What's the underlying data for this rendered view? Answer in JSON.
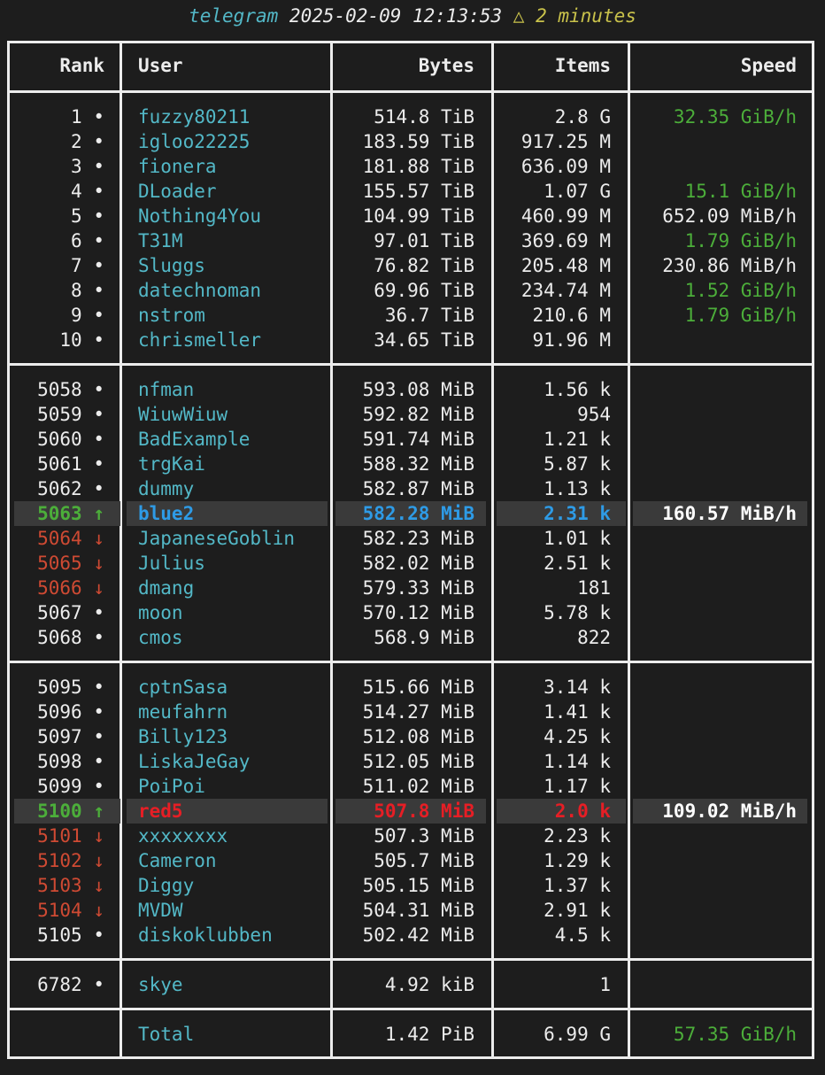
{
  "title": {
    "app": "telegram",
    "timestamp": "2025-02-09 12:13:53",
    "ago": "△ 2 minutes"
  },
  "headers": {
    "rank": "Rank",
    "user": "User",
    "bytes": "Bytes",
    "items": "Items",
    "speed": "Speed"
  },
  "groups": [
    {
      "rows": [
        {
          "rank": "1",
          "marker": "•",
          "trend": "same",
          "user": "fuzzy80211",
          "bytes": "514.8 TiB",
          "items": "2.8 G",
          "speed": "32.35 GiB/h",
          "speed_color": "green"
        },
        {
          "rank": "2",
          "marker": "•",
          "trend": "same",
          "user": "igloo22225",
          "bytes": "183.59 TiB",
          "items": "917.25 M",
          "speed": ""
        },
        {
          "rank": "3",
          "marker": "•",
          "trend": "same",
          "user": "fionera",
          "bytes": "181.88 TiB",
          "items": "636.09 M",
          "speed": ""
        },
        {
          "rank": "4",
          "marker": "•",
          "trend": "same",
          "user": "DLoader",
          "bytes": "155.57 TiB",
          "items": "1.07 G",
          "speed": "15.1 GiB/h",
          "speed_color": "green"
        },
        {
          "rank": "5",
          "marker": "•",
          "trend": "same",
          "user": "Nothing4You",
          "bytes": "104.99 TiB",
          "items": "460.99 M",
          "speed": "652.09 MiB/h",
          "speed_color": "white"
        },
        {
          "rank": "6",
          "marker": "•",
          "trend": "same",
          "user": "T31M",
          "bytes": "97.01 TiB",
          "items": "369.69 M",
          "speed": "1.79 GiB/h",
          "speed_color": "green"
        },
        {
          "rank": "7",
          "marker": "•",
          "trend": "same",
          "user": "Sluggs",
          "bytes": "76.82 TiB",
          "items": "205.48 M",
          "speed": "230.86 MiB/h",
          "speed_color": "white"
        },
        {
          "rank": "8",
          "marker": "•",
          "trend": "same",
          "user": "datechnoman",
          "bytes": "69.96 TiB",
          "items": "234.74 M",
          "speed": "1.52 GiB/h",
          "speed_color": "green"
        },
        {
          "rank": "9",
          "marker": "•",
          "trend": "same",
          "user": "nstrom",
          "bytes": "36.7 TiB",
          "items": "210.6 M",
          "speed": "1.79 GiB/h",
          "speed_color": "green"
        },
        {
          "rank": "10",
          "marker": "•",
          "trend": "same",
          "user": "chrismeller",
          "bytes": "34.65 TiB",
          "items": "91.96 M",
          "speed": ""
        }
      ]
    },
    {
      "speed": "160.57 MiB/h",
      "rows": [
        {
          "rank": "5058",
          "marker": "•",
          "trend": "same",
          "user": "nfman",
          "bytes": "593.08 MiB",
          "items": "1.56 k"
        },
        {
          "rank": "5059",
          "marker": "•",
          "trend": "same",
          "user": "WiuwWiuw",
          "bytes": "592.82 MiB",
          "items": "954"
        },
        {
          "rank": "5060",
          "marker": "•",
          "trend": "same",
          "user": "BadExample",
          "bytes": "591.74 MiB",
          "items": "1.21 k"
        },
        {
          "rank": "5061",
          "marker": "•",
          "trend": "same",
          "user": "trgKai",
          "bytes": "588.32 MiB",
          "items": "5.87 k"
        },
        {
          "rank": "5062",
          "marker": "•",
          "trend": "same",
          "user": "dummy",
          "bytes": "582.87 MiB",
          "items": "1.13 k"
        },
        {
          "rank": "5063",
          "marker": "↑",
          "trend": "up",
          "user": "blue2",
          "bytes": "582.28 MiB",
          "items": "2.31 k",
          "highlight": "blue"
        },
        {
          "rank": "5064",
          "marker": "↓",
          "trend": "down",
          "user": "JapaneseGoblin",
          "bytes": "582.23 MiB",
          "items": "1.01 k"
        },
        {
          "rank": "5065",
          "marker": "↓",
          "trend": "down",
          "user": "Julius",
          "bytes": "582.02 MiB",
          "items": "2.51 k"
        },
        {
          "rank": "5066",
          "marker": "↓",
          "trend": "down",
          "user": "dmang",
          "bytes": "579.33 MiB",
          "items": "181"
        },
        {
          "rank": "5067",
          "marker": "•",
          "trend": "same",
          "user": "moon",
          "bytes": "570.12 MiB",
          "items": "5.78 k"
        },
        {
          "rank": "5068",
          "marker": "•",
          "trend": "same",
          "user": "cmos",
          "bytes": "568.9 MiB",
          "items": "822"
        }
      ]
    },
    {
      "speed": "109.02 MiB/h",
      "rows": [
        {
          "rank": "5095",
          "marker": "•",
          "trend": "same",
          "user": "cptnSasa",
          "bytes": "515.66 MiB",
          "items": "3.14 k"
        },
        {
          "rank": "5096",
          "marker": "•",
          "trend": "same",
          "user": "meufahrn",
          "bytes": "514.27 MiB",
          "items": "1.41 k"
        },
        {
          "rank": "5097",
          "marker": "•",
          "trend": "same",
          "user": "Billy123",
          "bytes": "512.08 MiB",
          "items": "4.25 k"
        },
        {
          "rank": "5098",
          "marker": "•",
          "trend": "same",
          "user": "LiskaJeGay",
          "bytes": "512.05 MiB",
          "items": "1.14 k"
        },
        {
          "rank": "5099",
          "marker": "•",
          "trend": "same",
          "user": "PoiPoi",
          "bytes": "511.02 MiB",
          "items": "1.17 k"
        },
        {
          "rank": "5100",
          "marker": "↑",
          "trend": "up",
          "user": "red5",
          "bytes": "507.8 MiB",
          "items": "2.0 k",
          "highlight": "red"
        },
        {
          "rank": "5101",
          "marker": "↓",
          "trend": "down",
          "user": "xxxxxxxx",
          "bytes": "507.3 MiB",
          "items": "2.23 k"
        },
        {
          "rank": "5102",
          "marker": "↓",
          "trend": "down",
          "user": "Cameron",
          "bytes": "505.7 MiB",
          "items": "1.29 k"
        },
        {
          "rank": "5103",
          "marker": "↓",
          "trend": "down",
          "user": "Diggy",
          "bytes": "505.15 MiB",
          "items": "1.37 k"
        },
        {
          "rank": "5104",
          "marker": "↓",
          "trend": "down",
          "user": "MVDW",
          "bytes": "504.31 MiB",
          "items": "2.91 k"
        },
        {
          "rank": "5105",
          "marker": "•",
          "trend": "same",
          "user": "diskoklubben",
          "bytes": "502.42 MiB",
          "items": "4.5 k"
        }
      ]
    },
    {
      "rows": [
        {
          "rank": "6782",
          "marker": "•",
          "trend": "same",
          "user": "skye",
          "bytes": "4.92 kiB",
          "items": "1"
        }
      ]
    }
  ],
  "total": {
    "label": "Total",
    "bytes": "1.42 PiB",
    "items": "6.99 G",
    "speed": "57.35 GiB/h"
  },
  "colors": {
    "background": "#1d1d1d",
    "text": "#ececec",
    "user": "#53b8c7",
    "up": "#4cae3a",
    "down": "#cf4a33",
    "highlight_blue": "#2e9be6",
    "highlight_red": "#e61e25",
    "highlight_bg": "#3a3a3a"
  }
}
